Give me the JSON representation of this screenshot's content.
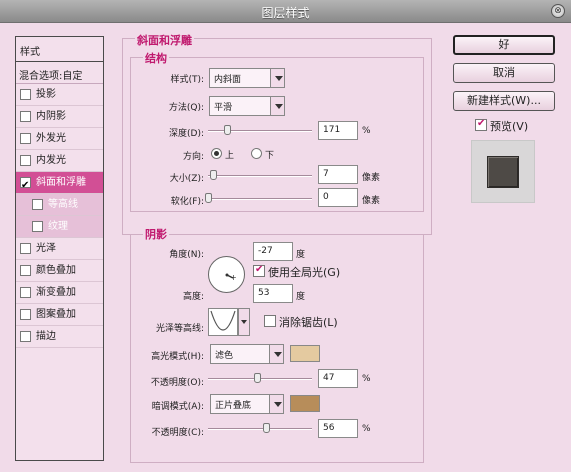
{
  "window": {
    "title": "图层样式",
    "close_glyph": "⊗"
  },
  "left_panel": {
    "header": "样式",
    "blend_options": "混合选项:自定",
    "items": [
      {
        "label": "投影",
        "checked": false
      },
      {
        "label": "内阴影",
        "checked": false
      },
      {
        "label": "外发光",
        "checked": false
      },
      {
        "label": "内发光",
        "checked": false
      },
      {
        "label": "斜面和浮雕",
        "checked": true,
        "active": true
      },
      {
        "label": "等高线",
        "checked": false,
        "sub": true
      },
      {
        "label": "纹理",
        "checked": false,
        "sub": true
      },
      {
        "label": "光泽",
        "checked": false
      },
      {
        "label": "颜色叠加",
        "checked": false
      },
      {
        "label": "渐变叠加",
        "checked": false
      },
      {
        "label": "图案叠加",
        "checked": false
      },
      {
        "label": "描边",
        "checked": false
      }
    ]
  },
  "bevel": {
    "section_title": "斜面和浮雕",
    "structure_title": "结构",
    "style_label": "样式(T):",
    "style_value": "内斜面",
    "technique_label": "方法(Q):",
    "technique_value": "平滑",
    "depth_label": "深度(D):",
    "depth_value": "171",
    "depth_unit": "%",
    "depth_slider": 0.18,
    "direction_label": "方向:",
    "dir_up": "上",
    "dir_down": "下",
    "direction_selected": "上",
    "size_label": "大小(Z):",
    "size_value": "7",
    "size_unit": "像素",
    "size_slider": 0.05,
    "soften_label": "软化(F):",
    "soften_value": "0",
    "soften_unit": "像素",
    "soften_slider": 0.0
  },
  "shading": {
    "section_title": "阴影",
    "angle_label": "角度(N):",
    "angle_value": "-27",
    "angle_unit": "度",
    "global_light_label": "使用全局光(G)",
    "global_light_checked": true,
    "altitude_label": "高度:",
    "altitude_value": "53",
    "altitude_unit": "度",
    "gloss_contour_label": "光泽等高线:",
    "anti_alias_label": "消除锯齿(L)",
    "anti_alias_checked": false,
    "highlight_mode_label": "高光模式(H):",
    "highlight_mode_value": "滤色",
    "highlight_color": "#e4caa0",
    "hl_opacity_label": "不透明度(O):",
    "hl_opacity_value": "47",
    "hl_opacity_unit": "%",
    "hl_opacity_slider": 0.47,
    "shadow_mode_label": "暗调模式(A):",
    "shadow_mode_value": "正片叠底",
    "shadow_color": "#b78d5a",
    "sh_opacity_label": "不透明度(C):",
    "sh_opacity_value": "56",
    "sh_opacity_unit": "%",
    "sh_opacity_slider": 0.56
  },
  "buttons": {
    "ok": "好",
    "cancel": "取消",
    "new_style": "新建样式(W)...",
    "preview_label": "预览(V)",
    "preview_checked": true
  },
  "colors": {
    "accent": "#c0196e",
    "active_item": "#d24f95",
    "background": "#f1dbe9"
  }
}
